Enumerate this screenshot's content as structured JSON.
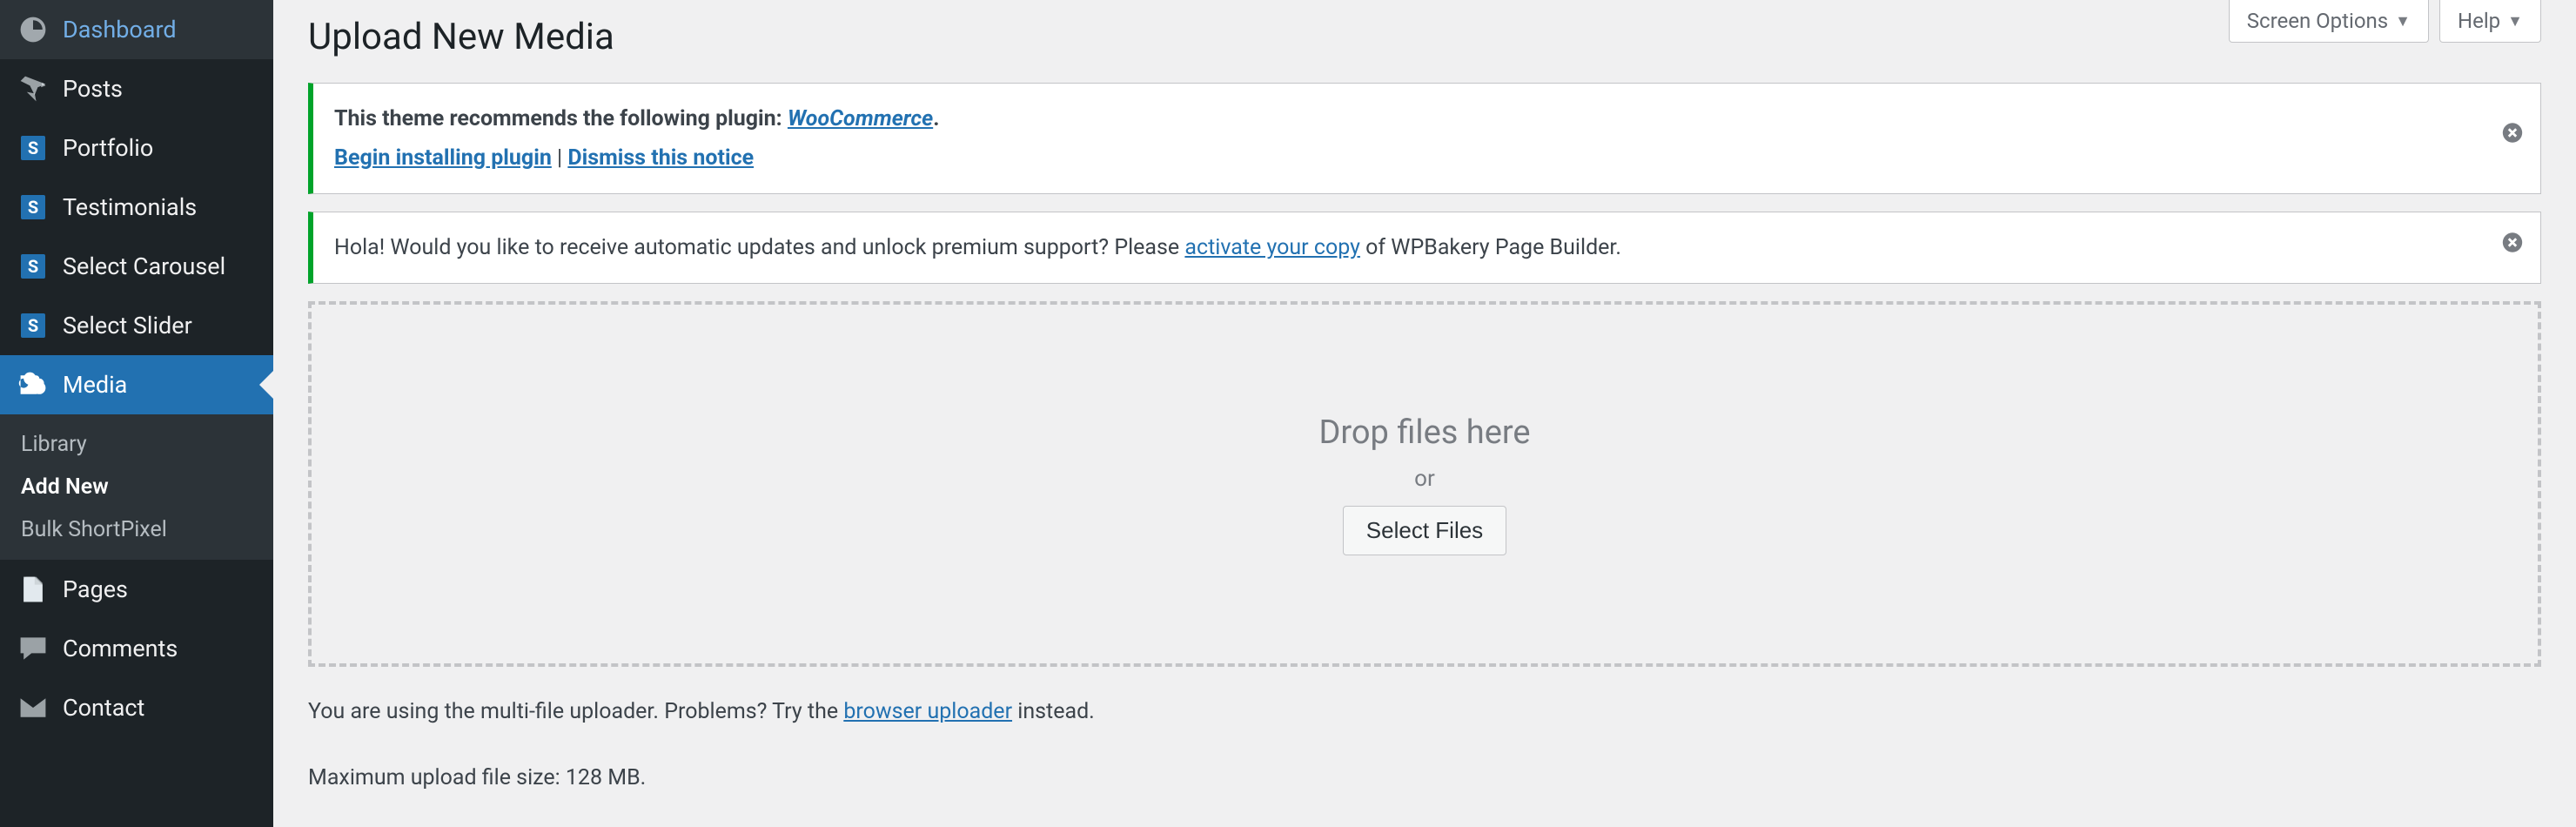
{
  "header": {
    "screen_options": "Screen Options",
    "help": "Help",
    "page_title": "Upload New Media"
  },
  "sidebar": {
    "items": [
      {
        "label": "Dashboard",
        "icon": "dashboard"
      },
      {
        "label": "Posts",
        "icon": "pin"
      },
      {
        "label": "Portfolio",
        "icon": "s"
      },
      {
        "label": "Testimonials",
        "icon": "s"
      },
      {
        "label": "Select Carousel",
        "icon": "s"
      },
      {
        "label": "Select Slider",
        "icon": "s"
      },
      {
        "label": "Media",
        "icon": "media"
      },
      {
        "label": "Pages",
        "icon": "page"
      },
      {
        "label": "Comments",
        "icon": "comment"
      },
      {
        "label": "Contact",
        "icon": "mail"
      }
    ],
    "active_index": 6,
    "submenu": {
      "items": [
        {
          "label": "Library"
        },
        {
          "label": "Add New"
        },
        {
          "label": "Bulk ShortPixel"
        }
      ],
      "current_index": 1
    }
  },
  "notices": [
    {
      "lines": {
        "prefix": "This theme recommends the following plugin: ",
        "plugin_name": "WooCommerce",
        "suffix": ".",
        "action_install": "Begin installing plugin",
        "separator": " | ",
        "action_dismiss": "Dismiss this notice"
      }
    },
    {
      "text_pre": "Hola! Would you like to receive automatic updates and unlock premium support? Please ",
      "link": "activate your copy",
      "text_post": " of WPBakery Page Builder."
    }
  ],
  "dropzone": {
    "title": "Drop files here",
    "or": "or",
    "button": "Select Files"
  },
  "footnotes": {
    "uploader_pre": "You are using the multi-file uploader. Problems? Try the ",
    "uploader_link": "browser uploader",
    "uploader_post": " instead.",
    "max_size": "Maximum upload file size: 128 MB."
  },
  "colors": {
    "accent": "#2271b1",
    "notice_border": "#00a32a"
  }
}
